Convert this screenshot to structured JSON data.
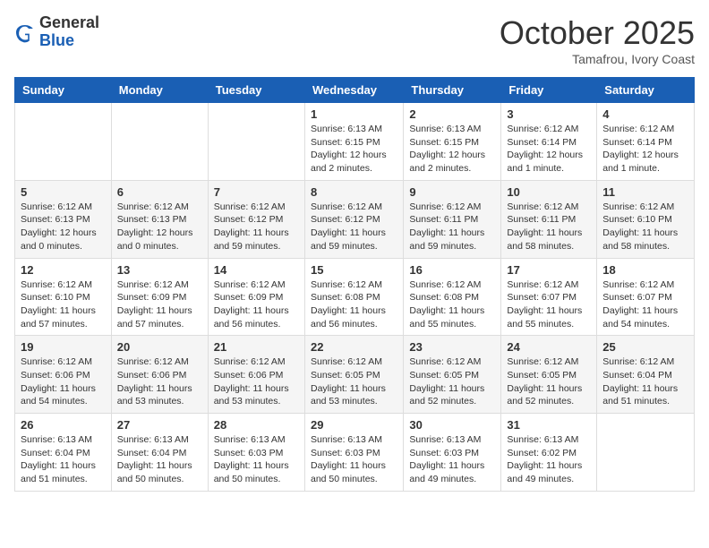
{
  "logo": {
    "general": "General",
    "blue": "Blue"
  },
  "title": "October 2025",
  "location": "Tamafrou, Ivory Coast",
  "weekdays": [
    "Sunday",
    "Monday",
    "Tuesday",
    "Wednesday",
    "Thursday",
    "Friday",
    "Saturday"
  ],
  "weeks": [
    [
      {
        "day": "",
        "info": ""
      },
      {
        "day": "",
        "info": ""
      },
      {
        "day": "",
        "info": ""
      },
      {
        "day": "1",
        "info": "Sunrise: 6:13 AM\nSunset: 6:15 PM\nDaylight: 12 hours and 2 minutes."
      },
      {
        "day": "2",
        "info": "Sunrise: 6:13 AM\nSunset: 6:15 PM\nDaylight: 12 hours and 2 minutes."
      },
      {
        "day": "3",
        "info": "Sunrise: 6:12 AM\nSunset: 6:14 PM\nDaylight: 12 hours and 1 minute."
      },
      {
        "day": "4",
        "info": "Sunrise: 6:12 AM\nSunset: 6:14 PM\nDaylight: 12 hours and 1 minute."
      }
    ],
    [
      {
        "day": "5",
        "info": "Sunrise: 6:12 AM\nSunset: 6:13 PM\nDaylight: 12 hours and 0 minutes."
      },
      {
        "day": "6",
        "info": "Sunrise: 6:12 AM\nSunset: 6:13 PM\nDaylight: 12 hours and 0 minutes."
      },
      {
        "day": "7",
        "info": "Sunrise: 6:12 AM\nSunset: 6:12 PM\nDaylight: 11 hours and 59 minutes."
      },
      {
        "day": "8",
        "info": "Sunrise: 6:12 AM\nSunset: 6:12 PM\nDaylight: 11 hours and 59 minutes."
      },
      {
        "day": "9",
        "info": "Sunrise: 6:12 AM\nSunset: 6:11 PM\nDaylight: 11 hours and 59 minutes."
      },
      {
        "day": "10",
        "info": "Sunrise: 6:12 AM\nSunset: 6:11 PM\nDaylight: 11 hours and 58 minutes."
      },
      {
        "day": "11",
        "info": "Sunrise: 6:12 AM\nSunset: 6:10 PM\nDaylight: 11 hours and 58 minutes."
      }
    ],
    [
      {
        "day": "12",
        "info": "Sunrise: 6:12 AM\nSunset: 6:10 PM\nDaylight: 11 hours and 57 minutes."
      },
      {
        "day": "13",
        "info": "Sunrise: 6:12 AM\nSunset: 6:09 PM\nDaylight: 11 hours and 57 minutes."
      },
      {
        "day": "14",
        "info": "Sunrise: 6:12 AM\nSunset: 6:09 PM\nDaylight: 11 hours and 56 minutes."
      },
      {
        "day": "15",
        "info": "Sunrise: 6:12 AM\nSunset: 6:08 PM\nDaylight: 11 hours and 56 minutes."
      },
      {
        "day": "16",
        "info": "Sunrise: 6:12 AM\nSunset: 6:08 PM\nDaylight: 11 hours and 55 minutes."
      },
      {
        "day": "17",
        "info": "Sunrise: 6:12 AM\nSunset: 6:07 PM\nDaylight: 11 hours and 55 minutes."
      },
      {
        "day": "18",
        "info": "Sunrise: 6:12 AM\nSunset: 6:07 PM\nDaylight: 11 hours and 54 minutes."
      }
    ],
    [
      {
        "day": "19",
        "info": "Sunrise: 6:12 AM\nSunset: 6:06 PM\nDaylight: 11 hours and 54 minutes."
      },
      {
        "day": "20",
        "info": "Sunrise: 6:12 AM\nSunset: 6:06 PM\nDaylight: 11 hours and 53 minutes."
      },
      {
        "day": "21",
        "info": "Sunrise: 6:12 AM\nSunset: 6:06 PM\nDaylight: 11 hours and 53 minutes."
      },
      {
        "day": "22",
        "info": "Sunrise: 6:12 AM\nSunset: 6:05 PM\nDaylight: 11 hours and 53 minutes."
      },
      {
        "day": "23",
        "info": "Sunrise: 6:12 AM\nSunset: 6:05 PM\nDaylight: 11 hours and 52 minutes."
      },
      {
        "day": "24",
        "info": "Sunrise: 6:12 AM\nSunset: 6:05 PM\nDaylight: 11 hours and 52 minutes."
      },
      {
        "day": "25",
        "info": "Sunrise: 6:12 AM\nSunset: 6:04 PM\nDaylight: 11 hours and 51 minutes."
      }
    ],
    [
      {
        "day": "26",
        "info": "Sunrise: 6:13 AM\nSunset: 6:04 PM\nDaylight: 11 hours and 51 minutes."
      },
      {
        "day": "27",
        "info": "Sunrise: 6:13 AM\nSunset: 6:04 PM\nDaylight: 11 hours and 50 minutes."
      },
      {
        "day": "28",
        "info": "Sunrise: 6:13 AM\nSunset: 6:03 PM\nDaylight: 11 hours and 50 minutes."
      },
      {
        "day": "29",
        "info": "Sunrise: 6:13 AM\nSunset: 6:03 PM\nDaylight: 11 hours and 50 minutes."
      },
      {
        "day": "30",
        "info": "Sunrise: 6:13 AM\nSunset: 6:03 PM\nDaylight: 11 hours and 49 minutes."
      },
      {
        "day": "31",
        "info": "Sunrise: 6:13 AM\nSunset: 6:02 PM\nDaylight: 11 hours and 49 minutes."
      },
      {
        "day": "",
        "info": ""
      }
    ]
  ]
}
